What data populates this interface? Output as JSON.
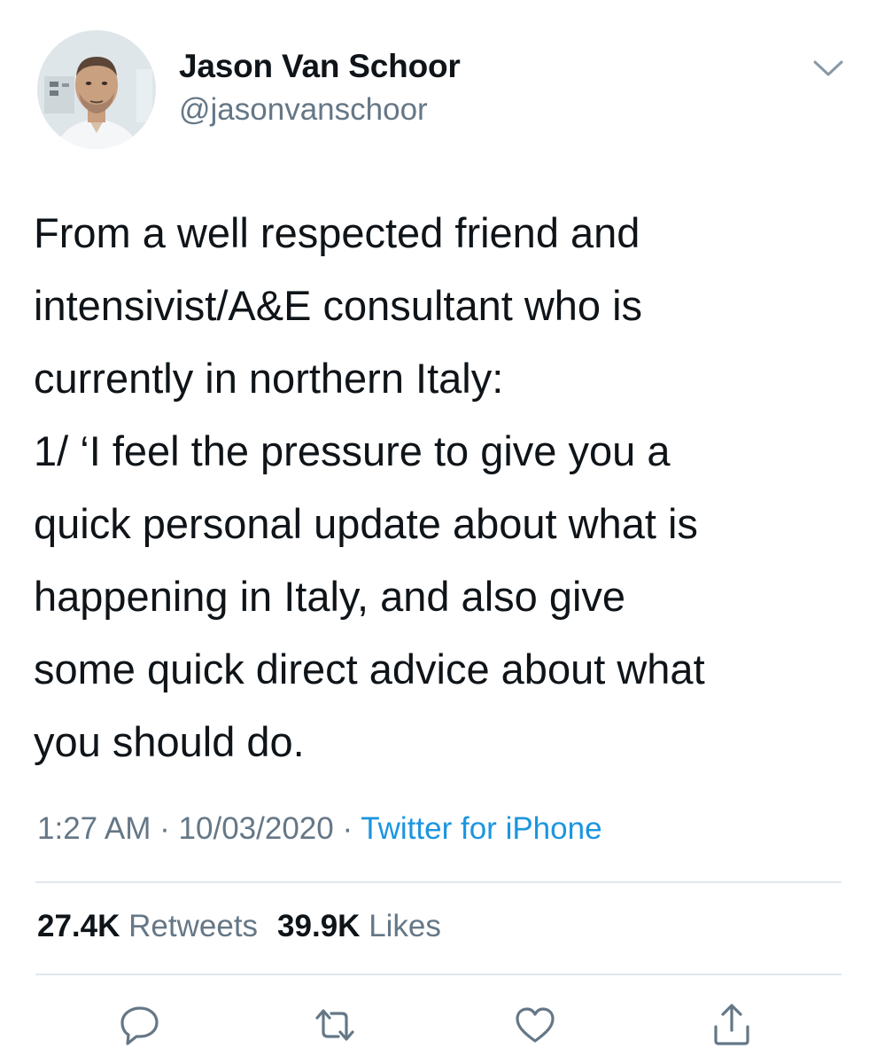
{
  "author": {
    "name": "Jason Van Schoor",
    "handle": "@jasonvanschoor"
  },
  "tweet": {
    "lines": [
      "From a well respected friend and",
      "intensivist/A&E consultant who is",
      "currently in northern Italy:",
      "1/ ‘I feel the pressure to give you a",
      "quick personal update about what is",
      "happening in Italy, and also give",
      "some quick direct advice about what",
      "you should do."
    ],
    "time": "1:27 AM",
    "date": "10/03/2020",
    "separator": "·",
    "source": "Twitter for iPhone"
  },
  "stats": {
    "retweets_count": "27.4K",
    "retweets_label": "Retweets",
    "likes_count": "39.9K",
    "likes_label": "Likes"
  },
  "actions": {
    "icons": [
      "reply-icon",
      "retweet-icon",
      "like-icon",
      "share-icon"
    ]
  },
  "colors": {
    "text": "#0f1419",
    "secondary": "#657786",
    "link": "#1b95e0",
    "divider": "#e1e8ed"
  }
}
